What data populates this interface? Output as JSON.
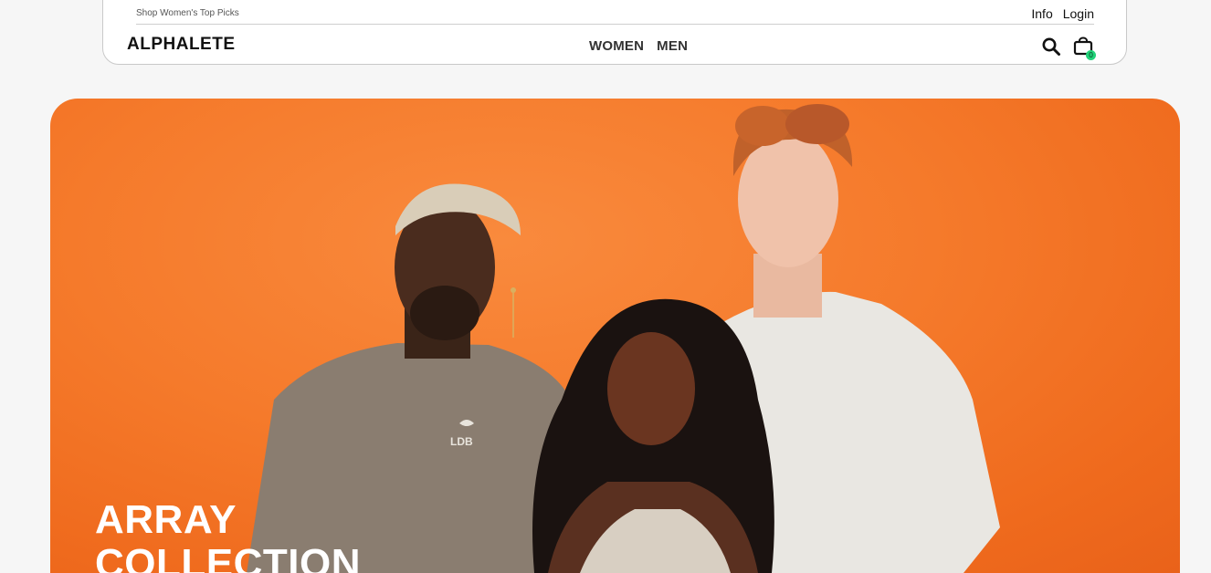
{
  "header": {
    "promo_text": "Shop Women's Top Picks",
    "util_links": [
      "Info",
      "Login"
    ],
    "logo": "ALPHALETE",
    "nav": [
      "WOMEN",
      "MEN"
    ],
    "icons": {
      "search": "search-icon",
      "cart": "shopping-bag-icon"
    },
    "cart_count": "0",
    "cart_badge_color": "#22d37a"
  },
  "hero": {
    "background_color": "#f57a2b",
    "title_line1": "ARRAY",
    "title_line2": "COLLECTION",
    "shirt_print": "LDB"
  }
}
